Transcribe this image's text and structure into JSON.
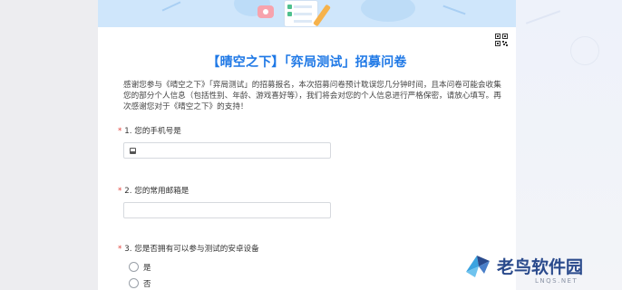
{
  "form": {
    "title": "【晴空之下】「弈局测试」招募问卷",
    "intro": "感谢您参与《晴空之下》「弈局测试」的招募报名，本次招募问卷预计耽误您几分钟时间，且本问卷可能会收集您的部分个人信息（包括性别、年龄、游戏喜好等），我们将会对您的个人信息进行严格保密，请放心填写。再次感谢您对于《晴空之下》的支持！",
    "required_mark": "*",
    "questions": [
      {
        "label": "1. 您的手机号是",
        "value": ""
      },
      {
        "label": "2. 您的常用邮箱是",
        "value": ""
      },
      {
        "label": "3. 您是否拥有可以参与测试的安卓设备",
        "options": [
          "是",
          "否"
        ]
      }
    ]
  },
  "watermark": {
    "text": "老鸟软件园",
    "url": "LNQS.NET"
  },
  "colors": {
    "title": "#1e78e6",
    "required": "#e2423b",
    "banner": "#cfe6fb"
  },
  "icons": [
    "qr-code-icon",
    "phone-icon",
    "bird-logo-icon"
  ]
}
